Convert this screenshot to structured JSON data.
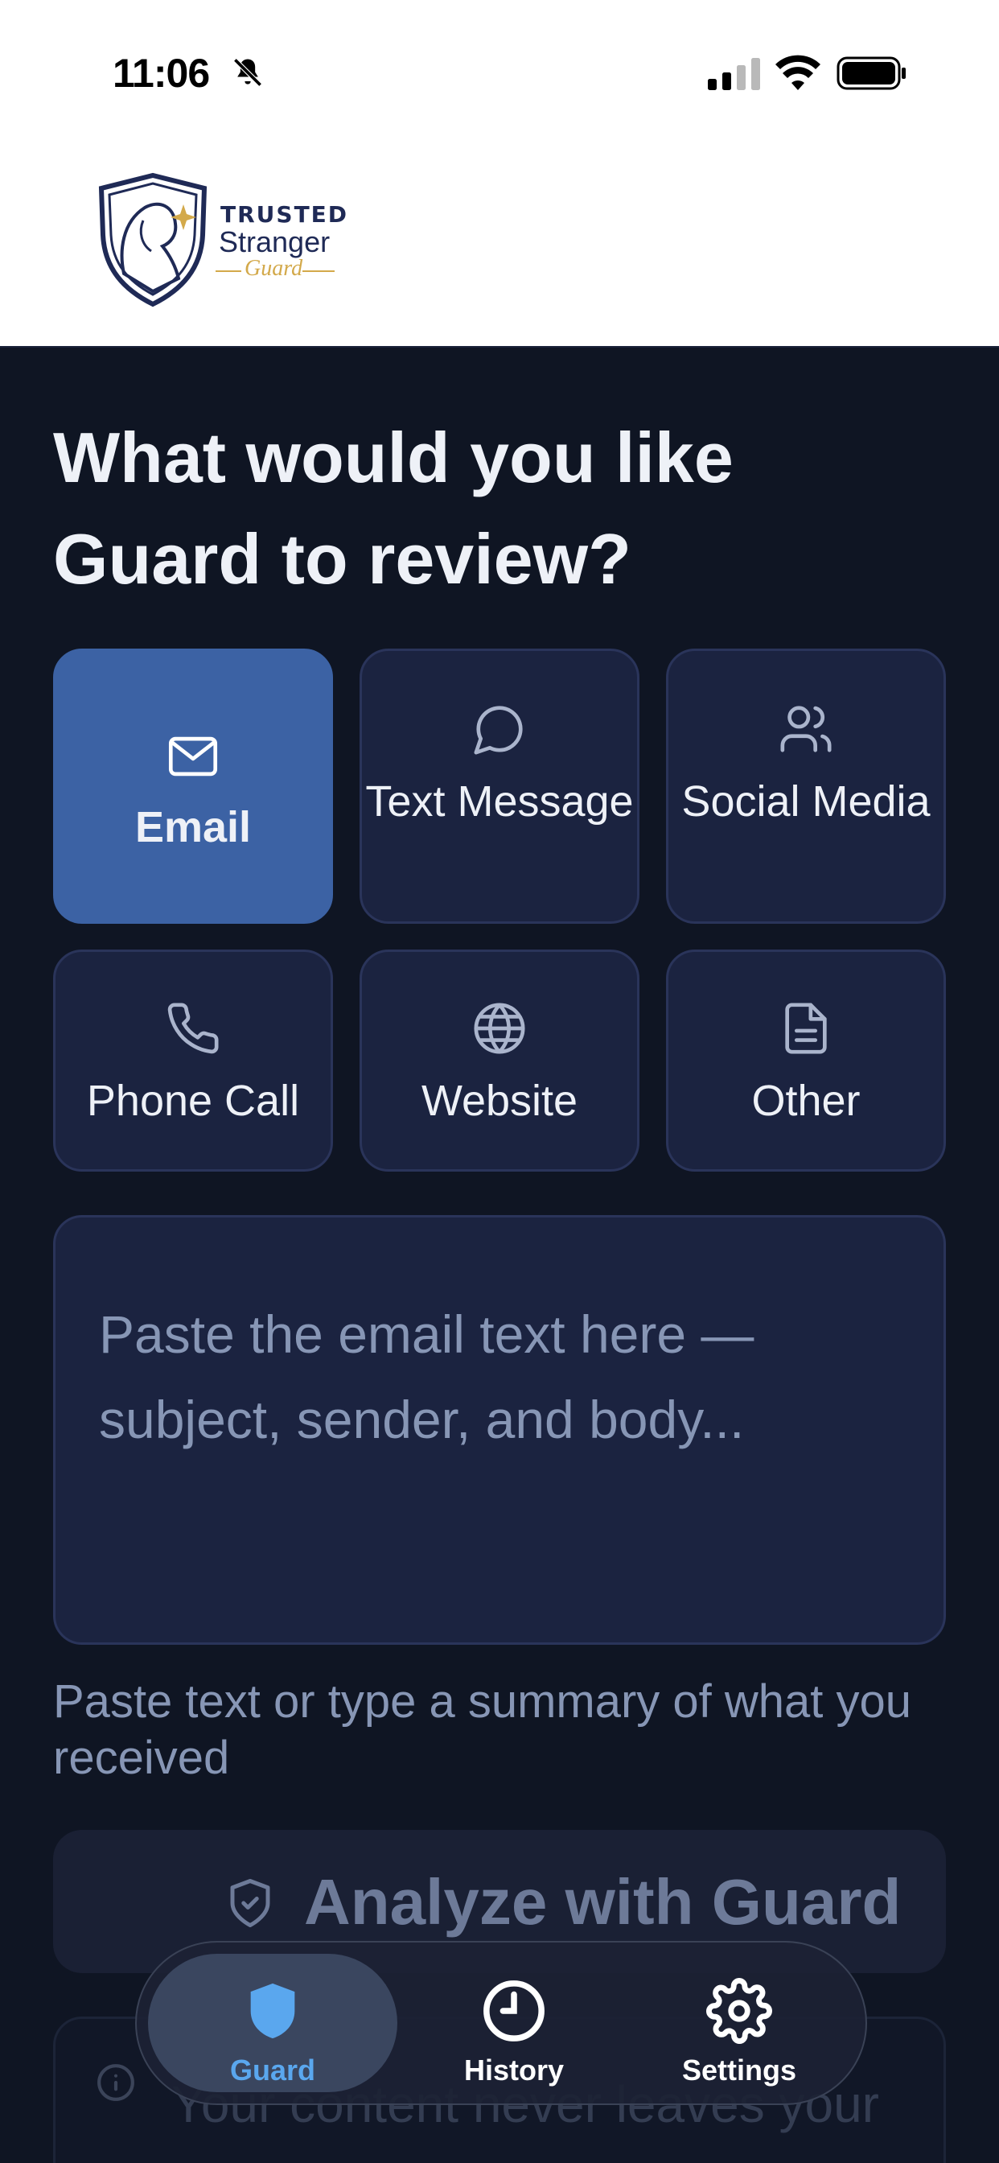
{
  "status_bar": {
    "time": "11:06"
  },
  "brand": {
    "line1": "TRUSTED",
    "line2": "Stranger",
    "line3": "Guard"
  },
  "heading": "What would you like Guard to review?",
  "categories": [
    {
      "label": "Email",
      "icon": "mail-icon",
      "selected": true
    },
    {
      "label": "Text Message",
      "icon": "chat-bubble-icon",
      "selected": false
    },
    {
      "label": "Social Media",
      "icon": "users-icon",
      "selected": false
    },
    {
      "label": "Phone Call",
      "icon": "phone-icon",
      "selected": false
    },
    {
      "label": "Website",
      "icon": "globe-icon",
      "selected": false
    },
    {
      "label": "Other",
      "icon": "document-icon",
      "selected": false
    }
  ],
  "input": {
    "placeholder": "Paste the email text here — subject, sender, and body..."
  },
  "hint": "Paste text or type a summary of what you received",
  "analyze_button": {
    "label": "Analyze with Guard",
    "icon": "shield-check-icon"
  },
  "privacy_note": {
    "text": "Your content never leaves your device. All analysis is done",
    "icon": "info-icon"
  },
  "tabbar": {
    "items": [
      {
        "label": "Guard",
        "icon": "shield-icon",
        "active": true
      },
      {
        "label": "History",
        "icon": "clock-icon",
        "active": false
      },
      {
        "label": "Settings",
        "icon": "gear-icon",
        "active": false
      }
    ]
  },
  "colors": {
    "accent": "#3c62a4",
    "tab_active": "#5aa7ee",
    "background": "#0f1523",
    "card": "#1b2340"
  }
}
